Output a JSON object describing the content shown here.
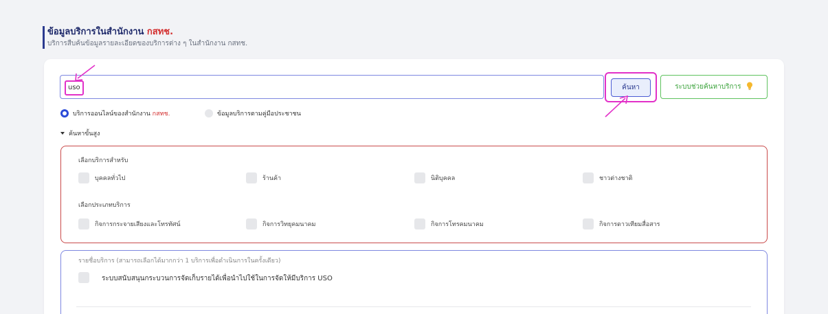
{
  "header": {
    "title": "ข้อมูลบริการในสำนักงาน",
    "title_brand": "กสทช.",
    "subtitle": "บริการสืบค้นข้อมูลรายละเอียดของบริการต่าง ๆ ในสำนักงาน กสทช."
  },
  "search": {
    "value": "uso",
    "button_label": "ค้นหา",
    "helper_label": "ระบบช่วยค้นหาบริการ",
    "helper_icon": "lightbulb-icon"
  },
  "scope": {
    "options": [
      {
        "label": "บริการออนไลน์ของสำนักงาน",
        "brand": "กสทช.",
        "selected": true
      },
      {
        "label": "ข้อมูลบริการตามคู่มือประชาชน",
        "brand": "",
        "selected": false
      }
    ]
  },
  "advanced": {
    "toggle_label": "ค้นหาขั้นสูง"
  },
  "filters": {
    "audience_label": "เลือกบริการสำหรับ",
    "audience": [
      "บุคคลทั่วไป",
      "ร้านค้า",
      "นิติบุคคล",
      "ชาวต่างชาติ"
    ],
    "type_label": "เลือกประเภทบริการ",
    "types": [
      "กิจการกระจายเสียงและโทรทัศน์",
      "กิจการวิทยุคมนาคม",
      "กิจการโทรคมนาคม",
      "กิจการดาวเทียมสื่อสาร"
    ]
  },
  "services": {
    "heading": "รายชื่อบริการ (สามารถเลือกได้มากกว่า 1 บริการเพื่อดำเนินการในครั้งเดียว)",
    "items": [
      "ระบบสนับสนุนกระบวนการจัดเก็บรายได้เพื่อนำไปใช้ในการจัดให้มีบริการ USO"
    ]
  },
  "colors": {
    "primary": "#2b3a8f",
    "brand_red": "#d32f2f",
    "helper_green": "#3aa23a",
    "annotation_magenta": "#e230c8"
  }
}
